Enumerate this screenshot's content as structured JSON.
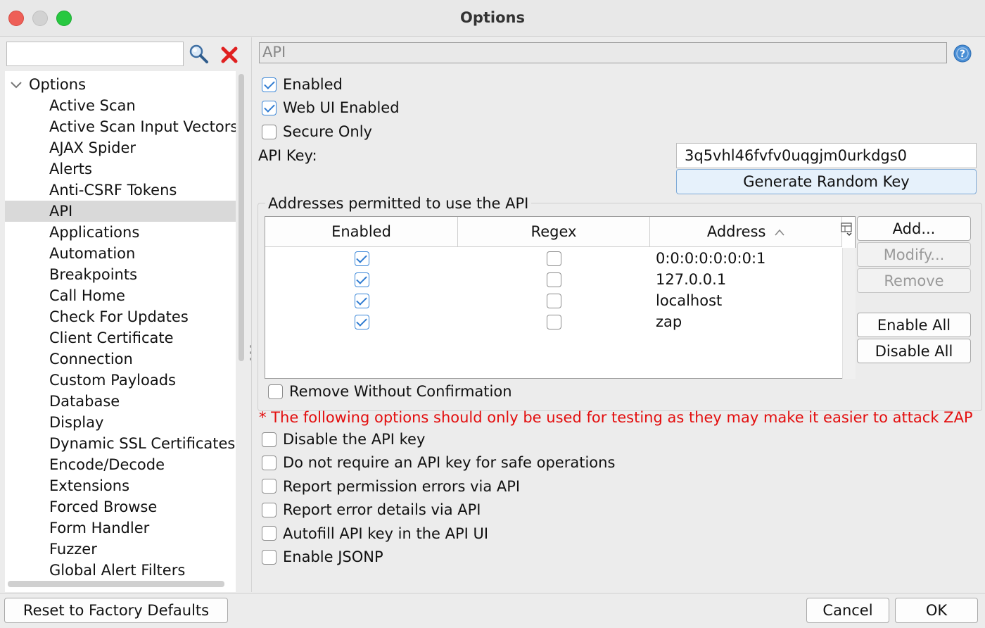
{
  "window": {
    "title": "Options"
  },
  "search": {
    "value": "",
    "placeholder": ""
  },
  "tree": {
    "root_label": "Options",
    "items": [
      "Active Scan",
      "Active Scan Input Vectors",
      "AJAX Spider",
      "Alerts",
      "Anti-CSRF Tokens",
      "API",
      "Applications",
      "Automation",
      "Breakpoints",
      "Call Home",
      "Check For Updates",
      "Client Certificate",
      "Connection",
      "Custom Payloads",
      "Database",
      "Display",
      "Dynamic SSL Certificates",
      "Encode/Decode",
      "Extensions",
      "Forced Browse",
      "Form Handler",
      "Fuzzer",
      "Global Alert Filters"
    ],
    "selected": "API"
  },
  "panel": {
    "title": "API",
    "enabled_label": "Enabled",
    "enabled_checked": true,
    "web_ui_label": "Web UI Enabled",
    "web_ui_checked": true,
    "secure_only_label": "Secure Only",
    "secure_only_checked": false,
    "api_key_label": "API Key:",
    "api_key_value": "3q5vhl46fvfv0uqgjm0urkdgs0",
    "generate_key_label": "Generate Random Key",
    "addresses_legend": "Addresses permitted to use the API",
    "table": {
      "columns": [
        "Enabled",
        "Regex",
        "Address"
      ],
      "sorted_column": "Address",
      "sort_direction": "ascending",
      "rows": [
        {
          "enabled": true,
          "regex": false,
          "address": "0:0:0:0:0:0:0:1"
        },
        {
          "enabled": true,
          "regex": false,
          "address": "127.0.0.1"
        },
        {
          "enabled": true,
          "regex": false,
          "address": "localhost"
        },
        {
          "enabled": true,
          "regex": false,
          "address": "zap"
        }
      ]
    },
    "buttons": {
      "add": "Add...",
      "modify": "Modify...",
      "remove": "Remove",
      "enable_all": "Enable All",
      "disable_all": "Disable All"
    },
    "remove_without_confirmation_label": "Remove Without Confirmation",
    "remove_without_confirmation_checked": false,
    "warning_text": "* The following options should only be used for testing as they may make it easier to attack ZAP",
    "warning_color": "#e30e0e",
    "testing_options": [
      {
        "label": "Disable the API key",
        "checked": false
      },
      {
        "label": "Do not require an API key for safe operations",
        "checked": false
      },
      {
        "label": "Report permission errors via API",
        "checked": false
      },
      {
        "label": "Report error details via API",
        "checked": false
      },
      {
        "label": "Autofill API key in the API UI",
        "checked": false
      },
      {
        "label": "Enable JSONP",
        "checked": false
      }
    ]
  },
  "footer": {
    "reset_label": "Reset to Factory Defaults",
    "cancel_label": "Cancel",
    "ok_label": "OK"
  }
}
